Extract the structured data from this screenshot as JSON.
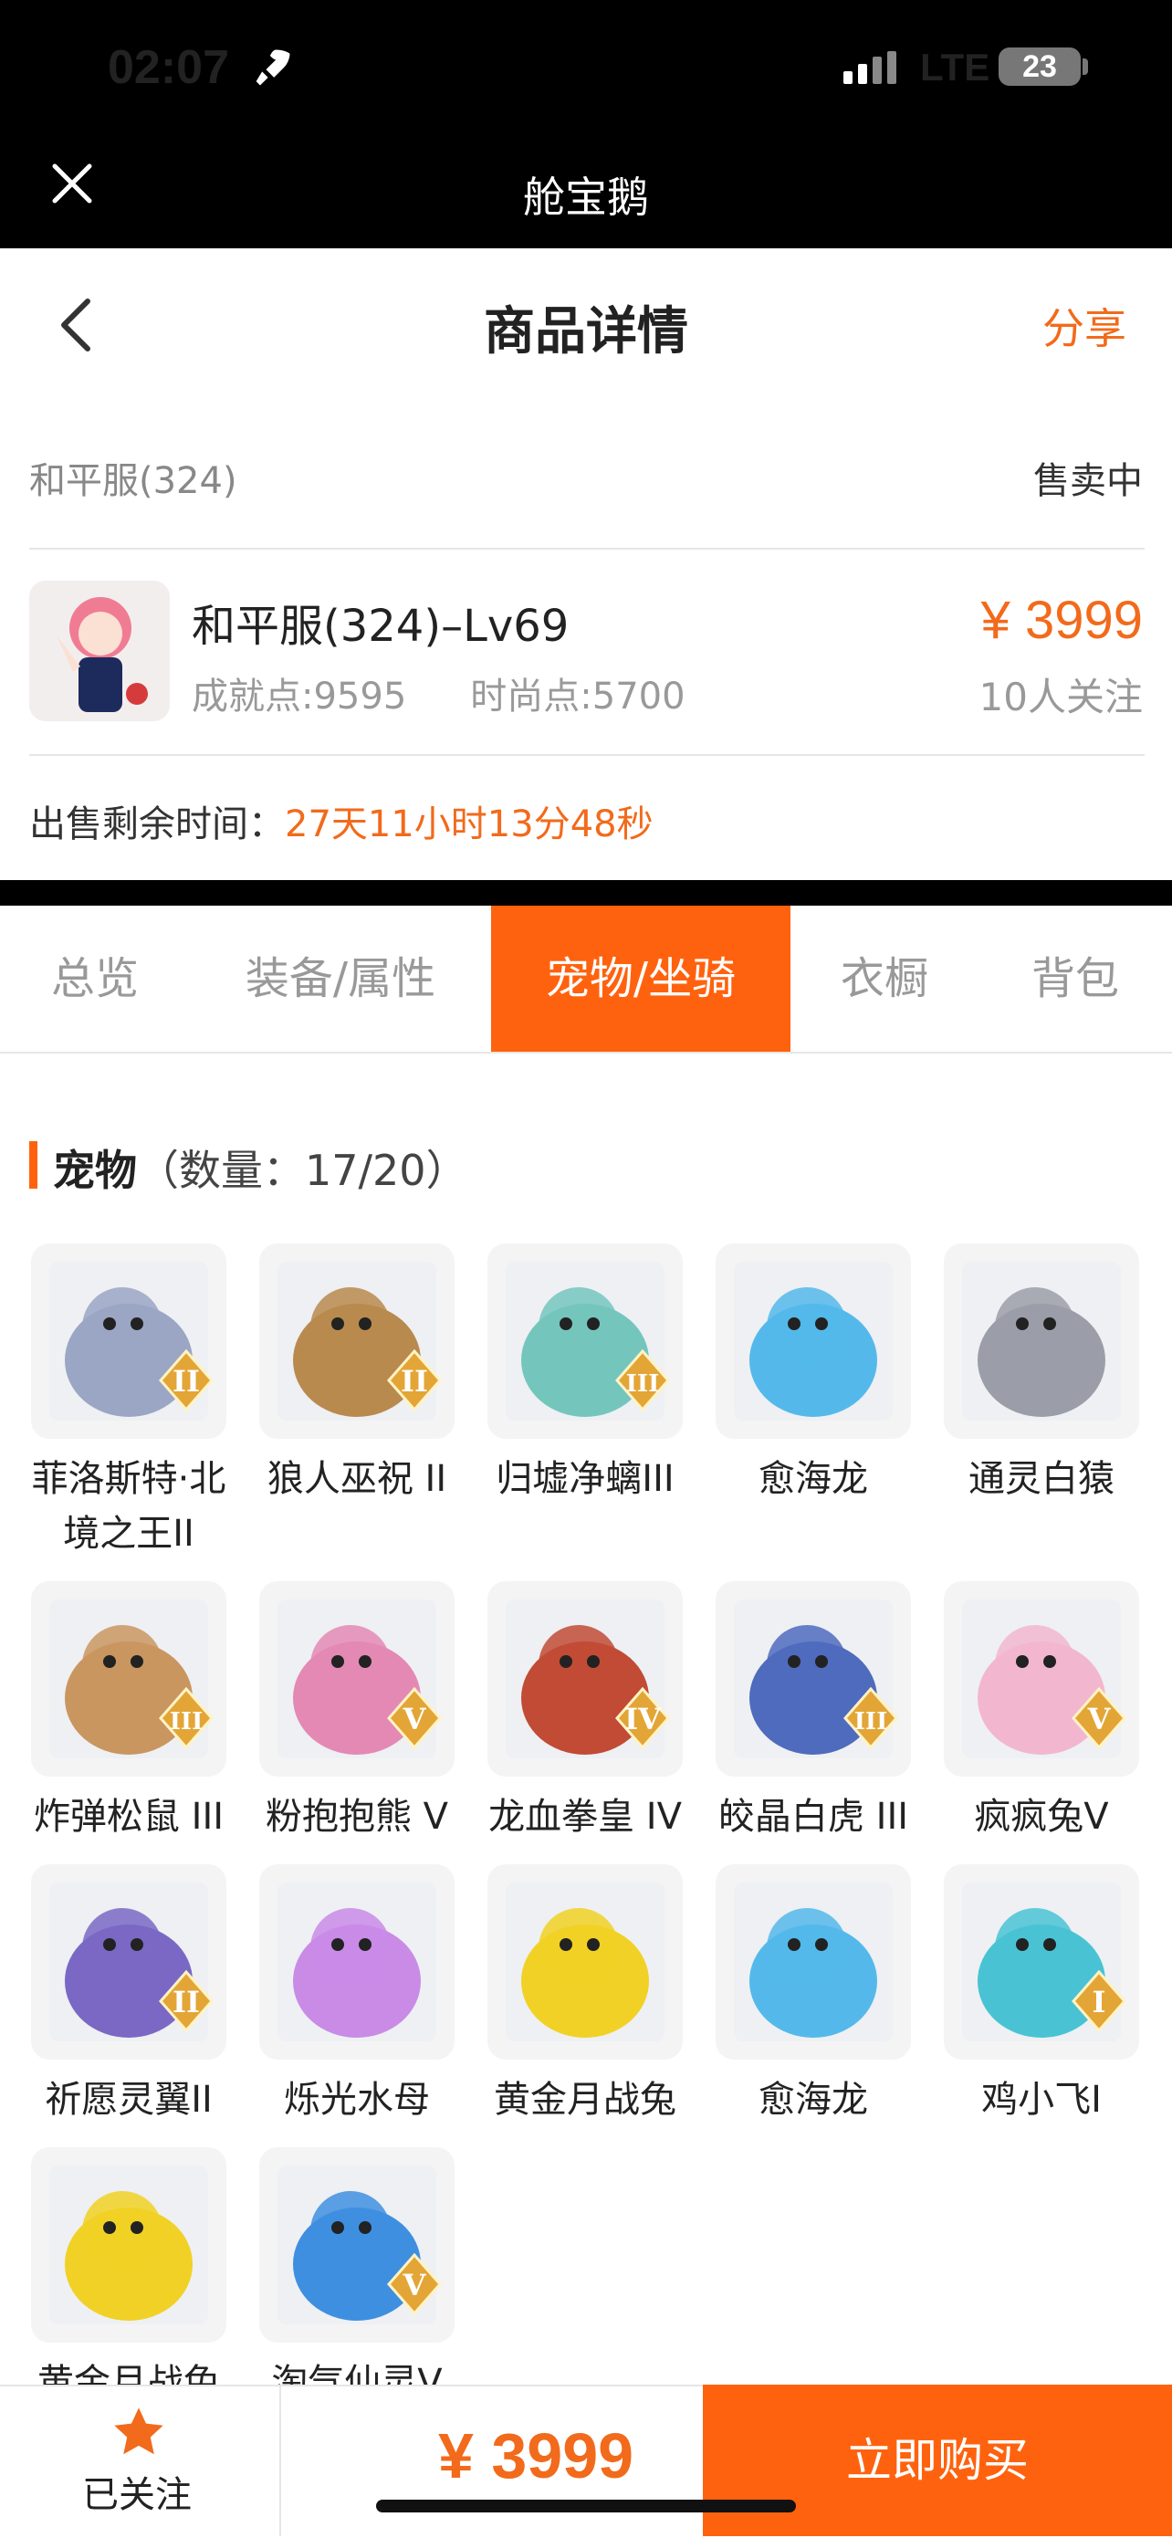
{
  "status_bar": {
    "time": "02:07",
    "network": "LTE",
    "battery": "23"
  },
  "app_bar": {
    "title": "舱宝鹅"
  },
  "nav": {
    "title": "商品详情",
    "share_label": "分享"
  },
  "listing": {
    "server": "和平服(324)",
    "status": "售卖中",
    "name": "和平服(324)–Lv69",
    "achievement": "成就点:9595",
    "fashion": "时尚点:5700",
    "price": "¥ 3999",
    "follows": "10人关注",
    "remaining_label": "出售剩余时间：",
    "remaining_value": "27天11小时13分48秒"
  },
  "tabs": [
    {
      "label": "总览"
    },
    {
      "label": "装备/属性"
    },
    {
      "label": "宠物/坐骑",
      "active": true
    },
    {
      "label": "衣橱"
    },
    {
      "label": "背包"
    }
  ],
  "section": {
    "title": "宠物",
    "count": "（数量：17/20）"
  },
  "pets": [
    {
      "name": "菲洛斯特·北境之王II",
      "tier": "II",
      "color": "#9aa6c4"
    },
    {
      "name": "狼人巫祝 II",
      "tier": "II",
      "color": "#b98a4e"
    },
    {
      "name": "归墟净螭III",
      "tier": "III",
      "color": "#74c6bd"
    },
    {
      "name": "愈海龙",
      "tier": "",
      "color": "#54b9ea"
    },
    {
      "name": "通灵白猿",
      "tier": "",
      "color": "#9b9ea8"
    },
    {
      "name": "炸弹松鼠 III",
      "tier": "III",
      "color": "#c99660"
    },
    {
      "name": "粉抱抱熊 V",
      "tier": "V",
      "color": "#e389b4"
    },
    {
      "name": "龙血拳皇 IV",
      "tier": "IV",
      "color": "#c14b35"
    },
    {
      "name": "皎晶白虎 III",
      "tier": "III",
      "color": "#4f6bbd"
    },
    {
      "name": "疯疯兔V",
      "tier": "V",
      "color": "#f2b7cf"
    },
    {
      "name": "祈愿灵翼II",
      "tier": "II",
      "color": "#7a68c4"
    },
    {
      "name": "烁光水母",
      "tier": "",
      "color": "#c98be6"
    },
    {
      "name": "黄金月战兔",
      "tier": "",
      "color": "#f1d125"
    },
    {
      "name": "愈海龙",
      "tier": "",
      "color": "#54b9ea"
    },
    {
      "name": "鸡小飞I",
      "tier": "I",
      "color": "#49c3d3"
    },
    {
      "name": "黄金月战兔",
      "tier": "",
      "color": "#f1d125"
    },
    {
      "name": "淘气仙灵V",
      "tier": "V",
      "color": "#3f8fe0"
    }
  ],
  "bottom_bar": {
    "followed_label": "已关注",
    "price": "¥ 3999",
    "buy_label": "立即购买"
  },
  "colors": {
    "accent": "#ff620e",
    "price": "#f26a1b"
  }
}
